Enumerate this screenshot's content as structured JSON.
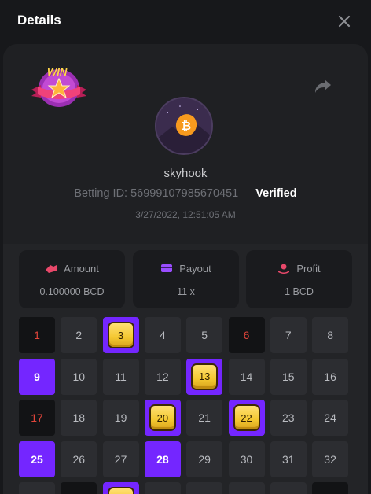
{
  "header": {
    "title": "Details"
  },
  "badge": {
    "text": "WIN"
  },
  "player": {
    "username": "skyhook",
    "betting_id_label": "Betting ID: 56999107985670451",
    "verified": "Verified",
    "datetime": "3/27/2022, 12:51:05 AM"
  },
  "stats": {
    "amount": {
      "label": "Amount",
      "value": "0.100000 BCD"
    },
    "payout": {
      "label": "Payout",
      "value": "11 x"
    },
    "profit": {
      "label": "Profit",
      "value": "1 BCD"
    }
  },
  "colors": {
    "purple": "#7426ff",
    "gold": "#f4c830",
    "red": "#e0453a",
    "amount_icon": "#e8486a",
    "payout_icon": "#9a4dff",
    "profit_icon": "#e8486a"
  },
  "board": {
    "cells": [
      {
        "n": "1",
        "state": "black"
      },
      {
        "n": "2",
        "state": "normal"
      },
      {
        "n": "3",
        "state": "gem"
      },
      {
        "n": "4",
        "state": "normal"
      },
      {
        "n": "5",
        "state": "normal"
      },
      {
        "n": "6",
        "state": "black"
      },
      {
        "n": "7",
        "state": "normal"
      },
      {
        "n": "8",
        "state": "normal"
      },
      {
        "n": "9",
        "state": "purple"
      },
      {
        "n": "10",
        "state": "normal"
      },
      {
        "n": "11",
        "state": "normal"
      },
      {
        "n": "12",
        "state": "normal"
      },
      {
        "n": "13",
        "state": "gem"
      },
      {
        "n": "14",
        "state": "normal"
      },
      {
        "n": "15",
        "state": "normal"
      },
      {
        "n": "16",
        "state": "normal"
      },
      {
        "n": "17",
        "state": "black"
      },
      {
        "n": "18",
        "state": "normal"
      },
      {
        "n": "19",
        "state": "normal"
      },
      {
        "n": "20",
        "state": "gem"
      },
      {
        "n": "21",
        "state": "normal"
      },
      {
        "n": "22",
        "state": "gem"
      },
      {
        "n": "23",
        "state": "normal"
      },
      {
        "n": "24",
        "state": "normal"
      },
      {
        "n": "25",
        "state": "purple"
      },
      {
        "n": "26",
        "state": "normal"
      },
      {
        "n": "27",
        "state": "normal"
      },
      {
        "n": "28",
        "state": "purple"
      },
      {
        "n": "29",
        "state": "normal"
      },
      {
        "n": "30",
        "state": "normal"
      },
      {
        "n": "31",
        "state": "normal"
      },
      {
        "n": "32",
        "state": "normal"
      },
      {
        "n": "",
        "state": "normal"
      },
      {
        "n": "",
        "state": "black"
      },
      {
        "n": "",
        "state": "gem"
      },
      {
        "n": "",
        "state": "normal"
      },
      {
        "n": "",
        "state": "normal"
      },
      {
        "n": "",
        "state": "normal"
      },
      {
        "n": "",
        "state": "normal"
      },
      {
        "n": "",
        "state": "black"
      }
    ]
  }
}
